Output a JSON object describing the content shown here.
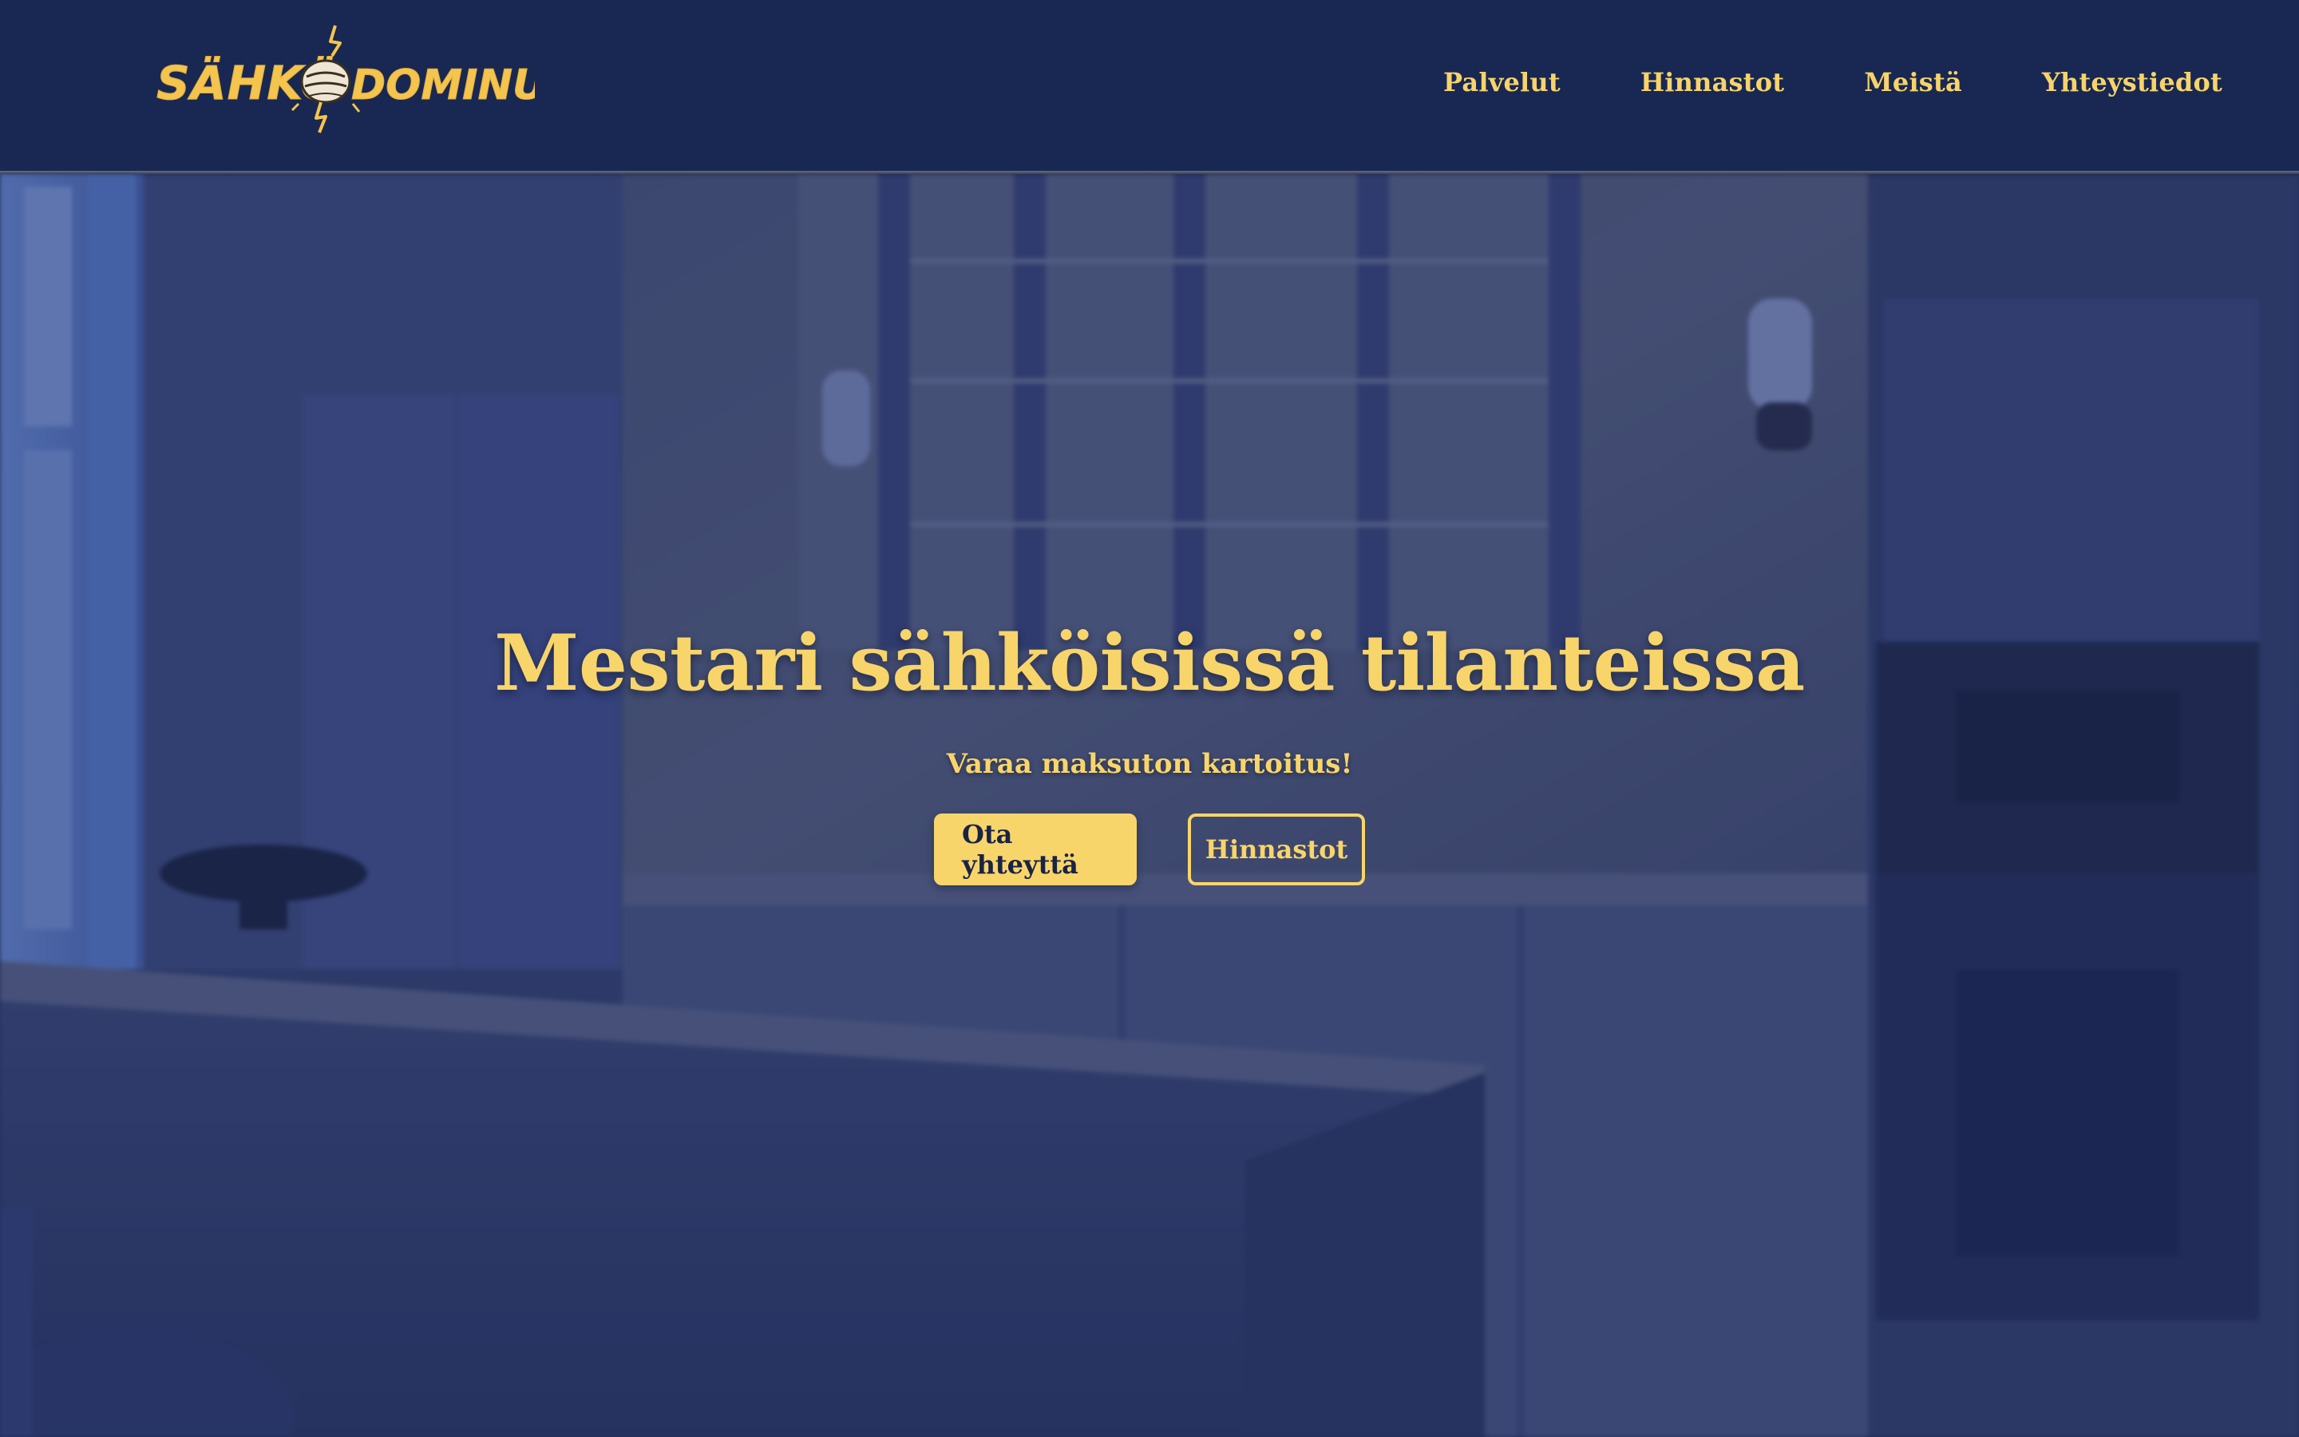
{
  "brand": {
    "name": "SÄHKÖ DOMINUS",
    "logo_left": "SÄHKÖ",
    "logo_right": "DOMINUS"
  },
  "nav": {
    "items": [
      {
        "label": "Palvelut"
      },
      {
        "label": "Hinnastot"
      },
      {
        "label": "Meistä"
      },
      {
        "label": "Yhteystiedot"
      }
    ]
  },
  "hero": {
    "title": "Mestari sähköisissä tilanteissa",
    "subtitle": "Varaa maksuton kartoitus!",
    "primary_button": "Ota yhteyttä",
    "secondary_button": "Hinnastot"
  },
  "colors": {
    "header_bg": "#182852",
    "accent": "#f8d56a",
    "button_text": "#1a2346"
  }
}
